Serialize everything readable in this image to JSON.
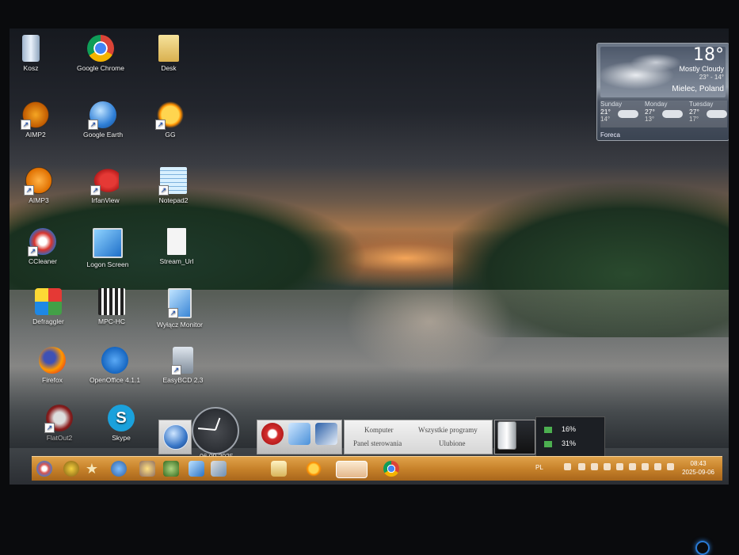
{
  "desktop": {
    "icons": [
      {
        "label": "Kosz",
        "icon": "recycle-bin-icon"
      },
      {
        "label": "Google Chrome",
        "icon": "chrome-icon"
      },
      {
        "label": "Desk",
        "icon": "folder-icon"
      },
      {
        "label": "AIMP2",
        "icon": "aimp-icon"
      },
      {
        "label": "Google Earth",
        "icon": "google-earth-icon"
      },
      {
        "label": "GG",
        "icon": "gg-sun-icon"
      },
      {
        "label": "AIMP3",
        "icon": "aimp-icon"
      },
      {
        "label": "IrfanView",
        "icon": "irfanview-icon"
      },
      {
        "label": "Notepad2",
        "icon": "notepad-icon"
      },
      {
        "label": "CCleaner",
        "icon": "ccleaner-icon"
      },
      {
        "label": "Logon Screen",
        "icon": "logon-screen-icon"
      },
      {
        "label": "Stream_Url",
        "icon": "document-icon"
      },
      {
        "label": "Defraggler",
        "icon": "defraggler-icon"
      },
      {
        "label": "MPC-HC",
        "icon": "mpc-hc-icon"
      },
      {
        "label": "Wyłącz Monitor",
        "icon": "monitor-icon"
      },
      {
        "label": "Firefox",
        "icon": "firefox-icon"
      },
      {
        "label": "OpenOffice 4.1.1",
        "icon": "openoffice-icon"
      },
      {
        "label": "EasyBCD 2.3",
        "icon": "easybcd-icon"
      },
      {
        "label": "FlatOut2",
        "icon": "flatout-icon"
      },
      {
        "label": "Skype",
        "icon": "skype-icon"
      }
    ]
  },
  "weather": {
    "temperature": "18°",
    "condition": "Mostly Cloudy",
    "range": "23° - 14°",
    "location": "Mielec, Poland",
    "days": [
      {
        "name": "Sunday",
        "high": "21°",
        "low": "14°"
      },
      {
        "name": "Monday",
        "high": "27°",
        "low": "13°"
      },
      {
        "name": "Tuesday",
        "high": "27°",
        "low": "17°"
      }
    ],
    "source": "Foreca"
  },
  "start_panel": {
    "date": "06.09.2025",
    "menu": {
      "computer": "Komputer",
      "all_programs": "Wszystkie programy",
      "control_panel": "Panel sterowania",
      "favorites": "Ulubione"
    },
    "usage": [
      {
        "value": "16%",
        "color": "#4caf50"
      },
      {
        "value": "31%",
        "color": "#4caf50"
      }
    ]
  },
  "taskbar": {
    "language": "PL",
    "time": "08:43",
    "date": "2025-09-06"
  },
  "colors": {
    "taskbar": "#c7822b",
    "accent_blue": "#2a7bd6"
  }
}
